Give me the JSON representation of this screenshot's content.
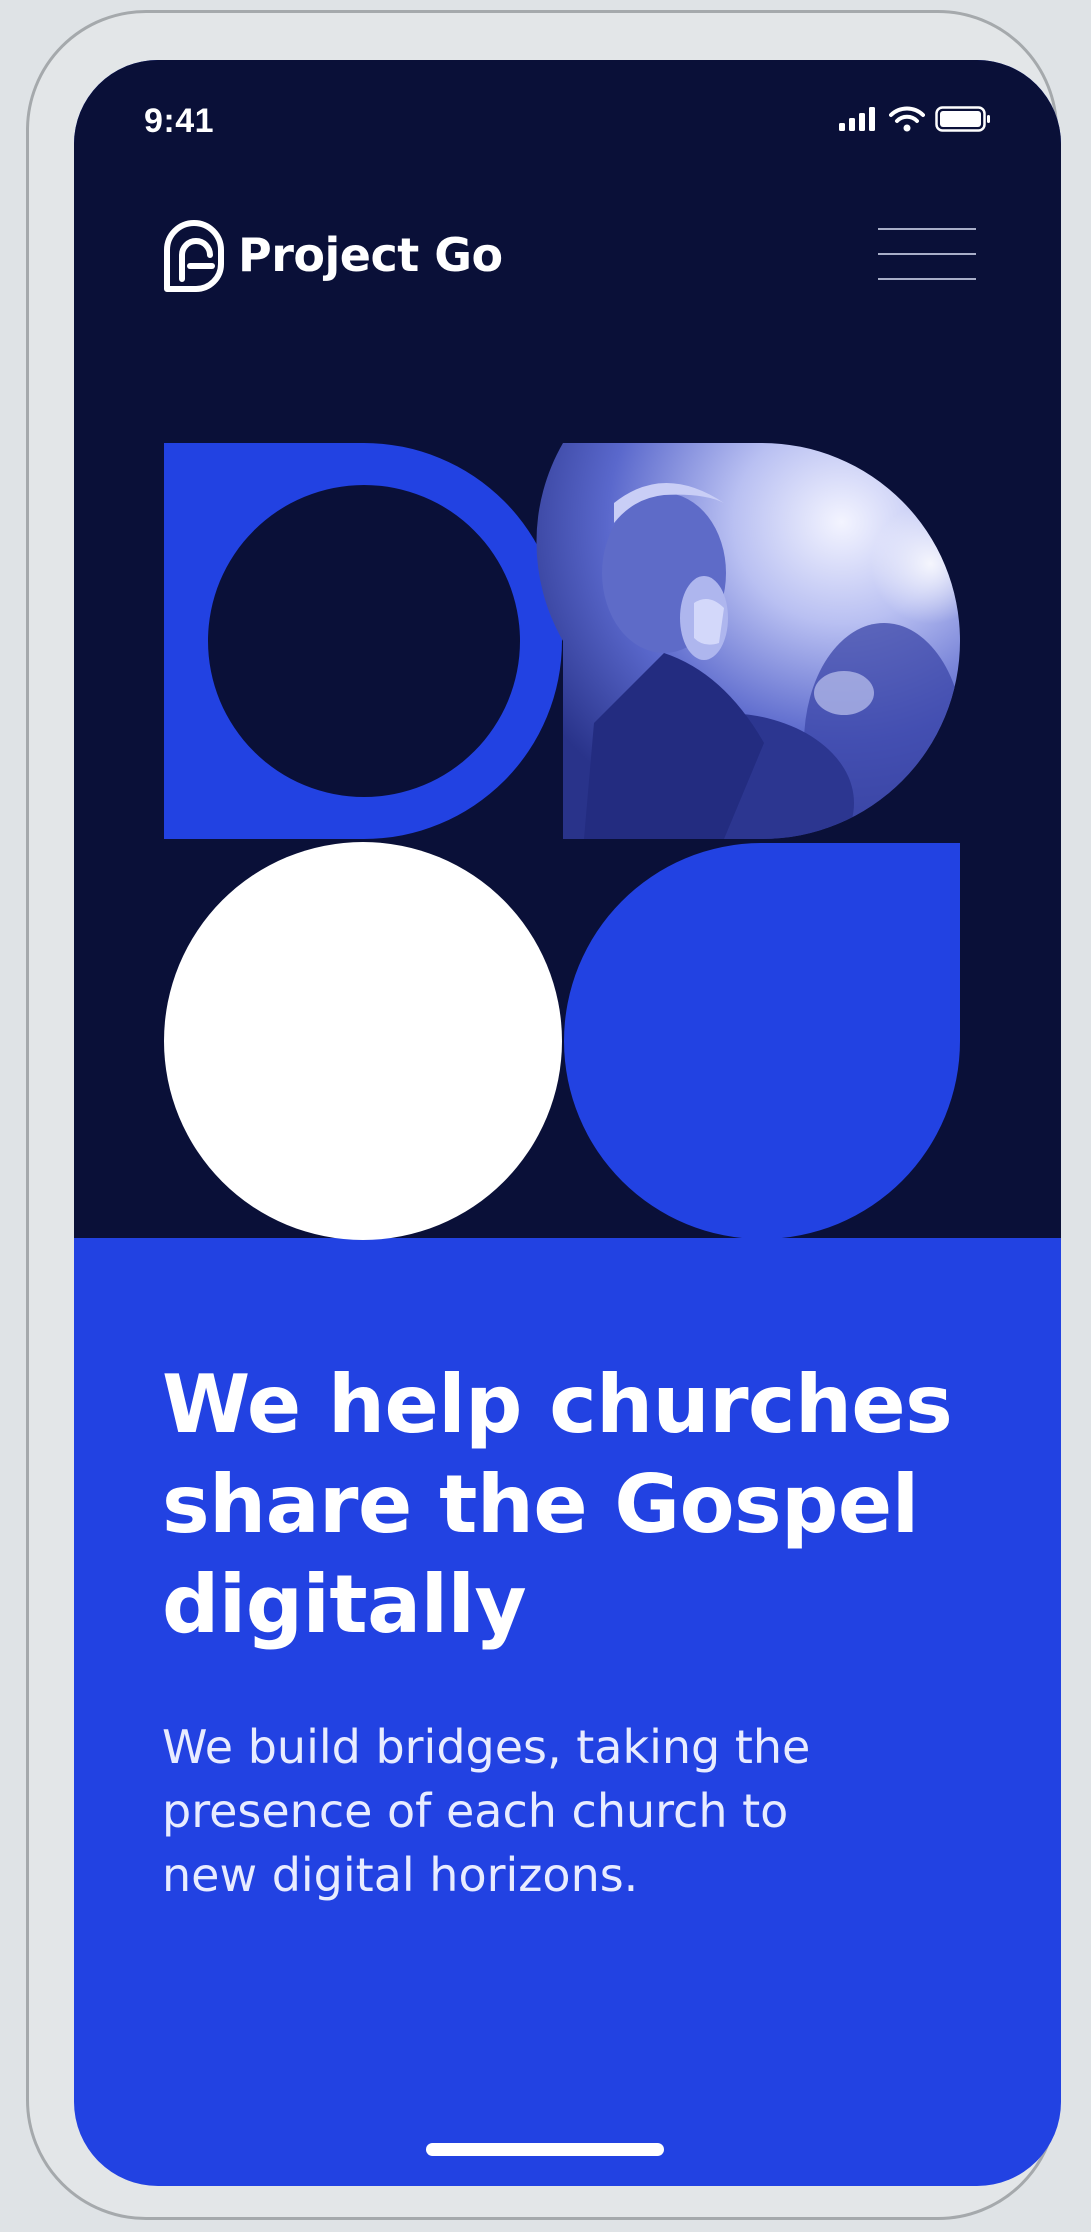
{
  "colors": {
    "hero_background": "#0A1038",
    "brand_blue": "#2242E2",
    "white": "#FFFFFF",
    "device_frame": "#DFE3E6"
  },
  "status_bar": {
    "time": "9:41",
    "icons": [
      "cellular-signal-icon",
      "wifi-icon",
      "battery-icon"
    ]
  },
  "nav": {
    "brand_name": "Project Go",
    "logo_icon": "project-go-logo-icon",
    "menu_icon": "hamburger-menu-icon"
  },
  "hero": {
    "shapes": [
      "blue-ring-shape",
      "photo-circle-shape",
      "white-circle-shape",
      "blue-drop-shape"
    ],
    "photo_icon": "person-praying-photo"
  },
  "content": {
    "headline_lines": [
      "We help churches",
      "share the Gospel",
      "digitally"
    ],
    "subtitle_lines": [
      "We build bridges, taking the",
      "presence of each church to",
      "new digital horizons."
    ]
  }
}
